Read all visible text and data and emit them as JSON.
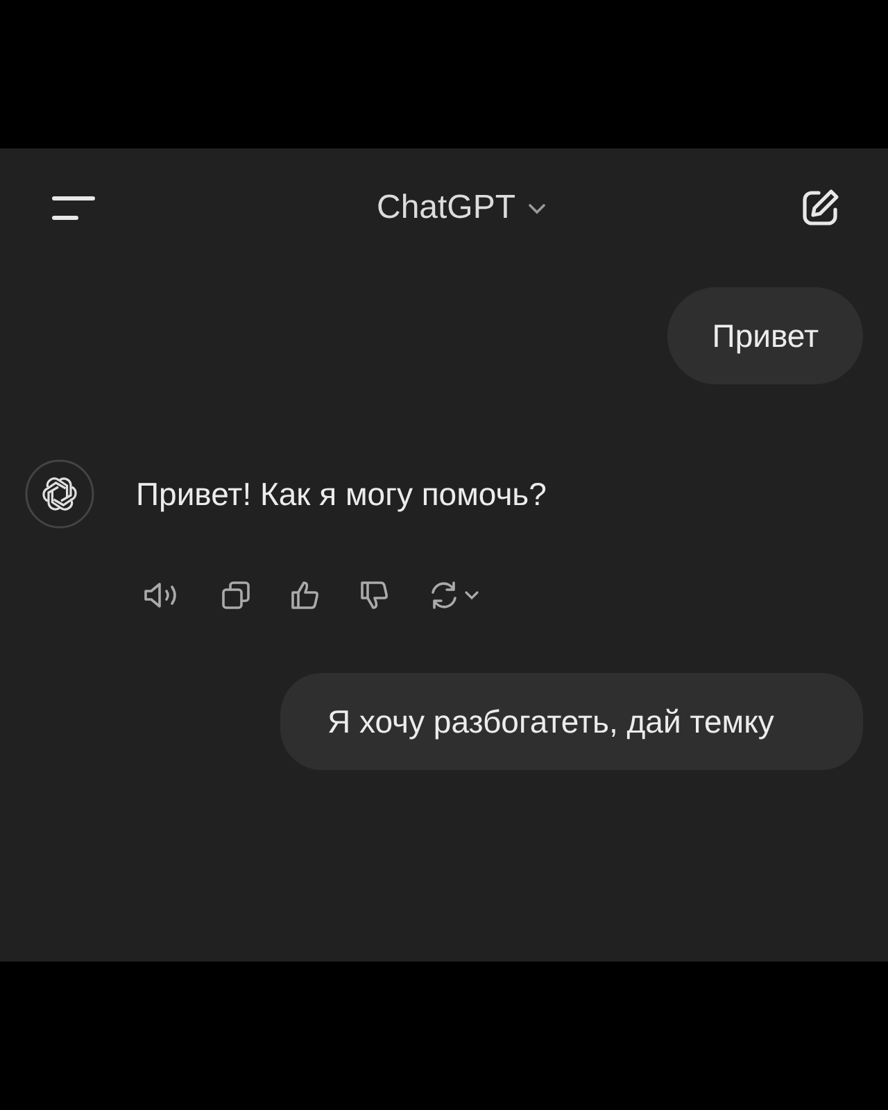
{
  "header": {
    "title": "ChatGPT"
  },
  "messages": [
    {
      "kind": "user",
      "text": "Привет"
    },
    {
      "kind": "assistant",
      "text": "Привет! Как я могу помочь?"
    },
    {
      "kind": "user",
      "text": "Я хочу разбогатеть, дай темку"
    }
  ]
}
